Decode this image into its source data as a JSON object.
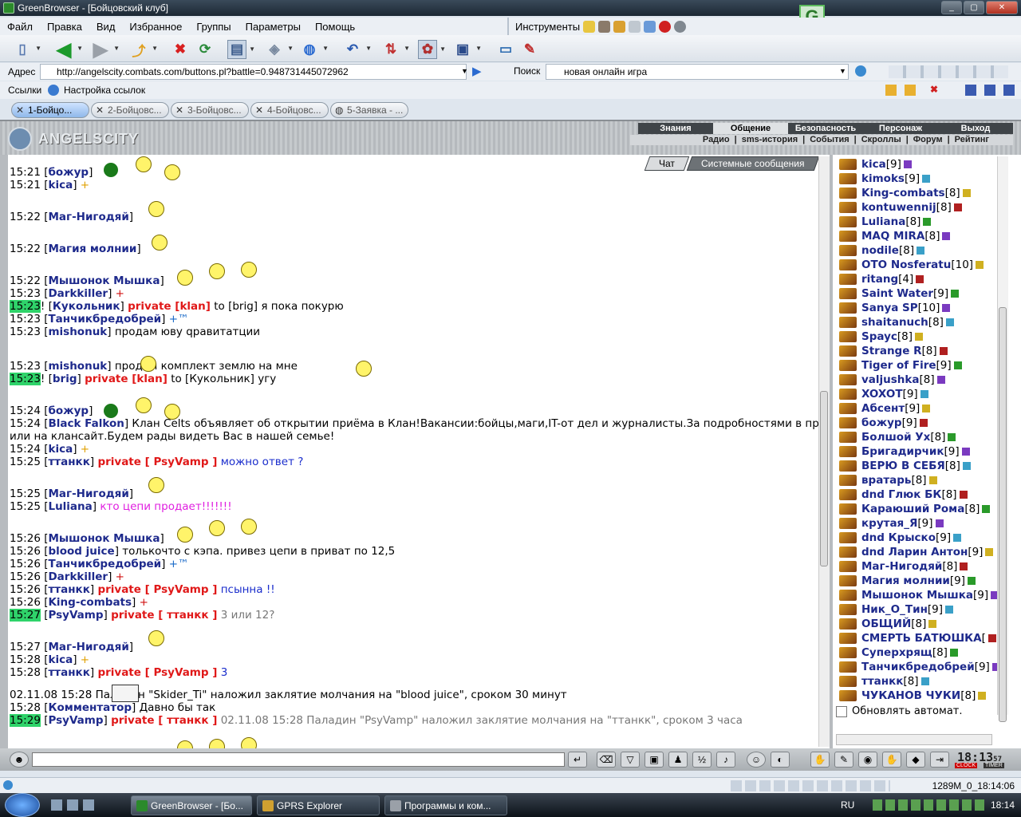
{
  "window": {
    "title": "GreenBrowser - [Бойцовский клуб]"
  },
  "menu": [
    "Файл",
    "Правка",
    "Вид",
    "Избранное",
    "Группы",
    "Параметры",
    "Помощь"
  ],
  "tools": {
    "label": "Инструменты"
  },
  "address": {
    "label": "Адрес",
    "url": "http://angelscity.combats.com/buttons.pl?battle=0.948731445072962"
  },
  "search": {
    "label": "Поиск",
    "value": "новая онлайн игра"
  },
  "links": {
    "label": "Ссылки",
    "item": "Настройка ссылок"
  },
  "tabs": [
    "1-Бойцо...",
    "2-Бойцовс...",
    "3-Бойцовс...",
    "4-Бойцовс...",
    "5-Заявка - ..."
  ],
  "game": {
    "logo": "ANGELSCITY",
    "nav1": [
      "Знания",
      "Общение",
      "Безопасность",
      "Персонаж",
      "Выход"
    ],
    "nav1_selected": "Общение",
    "nav2": [
      "Радио",
      "sms-история",
      "События",
      "Скроллы",
      "Форум",
      "Рейтинг"
    ]
  },
  "chat_tabs": [
    "Чат",
    "Системные сообщения"
  ],
  "chat": [
    {
      "time": "15:21",
      "nick": "божур",
      "rest": ""
    },
    {
      "time": "15:21",
      "nick": "kica",
      "plus": "+"
    },
    {
      "time": "15:22",
      "nick": "Маг-Нигодяй",
      "rest": ""
    },
    {
      "time": "15:22",
      "nick": "Магия молнии",
      "rest": ""
    },
    {
      "time": "15:22",
      "nick": "Мышонок Мышка",
      "rest": ""
    },
    {
      "time": "15:23",
      "nick": "Darkkiller",
      "plus": "+"
    },
    {
      "time": "15:23",
      "hl": true,
      "pre": "! ",
      "nick": "Кукольник",
      "priv": "private [klan]",
      "mid": " to [brig] ",
      "rest": "я пока покурю"
    },
    {
      "time": "15:23",
      "nick": "Танчикбредобрей",
      "plus": "+™"
    },
    {
      "time": "15:23",
      "nick": "mishonuk",
      "rest": "продам юву qравитатции"
    },
    {
      "time": "15:23",
      "nick": "mishonuk",
      "rest": "продам комплект землю на мне"
    },
    {
      "time": "15:23",
      "hl": true,
      "pre": "! ",
      "nick": "brig",
      "priv": "private [klan]",
      "mid": " to [Кукольник] ",
      "rest": "угу"
    },
    {
      "time": "15:24",
      "nick": "божур",
      "rest": ""
    },
    {
      "time": "15:24",
      "nick": "Black Falkon",
      "rest": "Клан Celts объявляет об открытии приёма в Клан!Вакансии:бойцы,маги,IT-от дел и журналисты.За подробностями в приват"
    },
    {
      "cont": "или на клансайт.Будем рады видеть Вас в нашей семье!"
    },
    {
      "time": "15:24",
      "nick": "kica",
      "plus": "+"
    },
    {
      "time": "15:25",
      "nick": "ттанкк",
      "priv": "private [ PsyVamp ]",
      "rest": "можно ответ ?"
    },
    {
      "time": "15:25",
      "nick": "Маг-Нигодяй",
      "rest": ""
    },
    {
      "time": "15:25",
      "nick": "Luliana",
      "rest": "кто цепи продает!!!!!!!"
    },
    {
      "time": "15:26",
      "nick": "Мышонок Мышка",
      "rest": ""
    },
    {
      "time": "15:26",
      "nick": "blood juice",
      "rest": "толькочто с кэпа. привез цепи в приват по 12,5"
    },
    {
      "time": "15:26",
      "nick": "Танчикбредобрей",
      "plus": "+™"
    },
    {
      "time": "15:26",
      "nick": "Darkkiller",
      "plus": "+"
    },
    {
      "time": "15:26",
      "nick": "ттанкк",
      "priv": "private [ PsyVamp ]",
      "rest": "псынна !!"
    },
    {
      "time": "15:26",
      "nick": "King-combats",
      "plus": "+"
    },
    {
      "time": "15:27",
      "hl": true,
      "nick": "PsyVamp",
      "priv": "private [ ттанкк ]",
      "rest": "3 или 12?"
    },
    {
      "time": "15:27",
      "nick": "Маг-Нигодяй",
      "rest": ""
    },
    {
      "time": "15:28",
      "nick": "kica",
      "plus": "+"
    },
    {
      "time": "15:28",
      "nick": "ттанкк",
      "priv": "private [ PsyVamp ]",
      "rest": "3"
    },
    {
      "sys": "02.11.08 15:28",
      "rest": "Паладин \"Skider_Ti\" наложил заклятие молчания на \"blood juice\", сроком 30 минут"
    },
    {
      "time": "15:28",
      "nick": "Комментатор",
      "rest": "Давно бы так"
    },
    {
      "time": "15:29",
      "hl": true,
      "nick": "PsyVamp",
      "priv": "private [ ттанкк ]",
      "rest": "02.11.08 15:28 Паладин \"PsyVamp\" наложил заклятие молчания на \"ттанкк\", сроком 3 часа"
    }
  ],
  "users": [
    {
      "name": "kica",
      "lvl": "[9]"
    },
    {
      "name": "kimoks",
      "lvl": "[9]"
    },
    {
      "name": "King-combats",
      "lvl": "[8]"
    },
    {
      "name": "kontuwennij",
      "lvl": "[8]"
    },
    {
      "name": "Luliana",
      "lvl": "[8]"
    },
    {
      "name": "MAQ MIRA",
      "lvl": "[8]"
    },
    {
      "name": "nodile",
      "lvl": "[8]"
    },
    {
      "name": "OTO Nosferatu",
      "lvl": "[10]"
    },
    {
      "name": "ritang",
      "lvl": "[4]"
    },
    {
      "name": "Saint Water",
      "lvl": "[9]"
    },
    {
      "name": "Sanya SP",
      "lvl": "[10]"
    },
    {
      "name": "shaitanuch",
      "lvl": "[8]"
    },
    {
      "name": "Spayc",
      "lvl": "[8]"
    },
    {
      "name": "Strange R",
      "lvl": "[8]"
    },
    {
      "name": "Tiger of Fire",
      "lvl": "[9]"
    },
    {
      "name": "valjushka",
      "lvl": "[8]"
    },
    {
      "name": "XOXOT",
      "lvl": "[9]"
    },
    {
      "name": "Абсент",
      "lvl": "[9]"
    },
    {
      "name": "божур",
      "lvl": "[9]"
    },
    {
      "name": "Болшой Ух",
      "lvl": "[8]"
    },
    {
      "name": "Бригадирчик",
      "lvl": "[9]"
    },
    {
      "name": "ВЕРЮ В СЕБЯ",
      "lvl": "[8]"
    },
    {
      "name": "вратарь",
      "lvl": "[8]"
    },
    {
      "name": "dnd Глюк БК",
      "lvl": "[8]"
    },
    {
      "name": "Караюший Рома",
      "lvl": "[8]"
    },
    {
      "name": "крутая_Я",
      "lvl": "[9]"
    },
    {
      "name": "dnd Крыско",
      "lvl": "[9]"
    },
    {
      "name": "dnd Ларин Антон",
      "lvl": "[9]"
    },
    {
      "name": "Маг-Нигодяй",
      "lvl": "[8]"
    },
    {
      "name": "Магия молнии",
      "lvl": "[9]"
    },
    {
      "name": "Мышонок Мышка",
      "lvl": "[9]"
    },
    {
      "name": "Ник_О_Тин",
      "lvl": "[9]"
    },
    {
      "name": "ОБЩИЙ",
      "lvl": "[8]"
    },
    {
      "name": "СМЕРТЬ БАТЮШКА",
      "lvl": "["
    },
    {
      "name": "Суперхрящ",
      "lvl": "[8]"
    },
    {
      "name": "Танчикбредобрей",
      "lvl": "[9]"
    },
    {
      "name": "ттанкк",
      "lvl": "[8]"
    },
    {
      "name": "ЧУКАНОВ ЧУКИ",
      "lvl": "[8]"
    }
  ],
  "auto_update": "Обновлять автомат.",
  "clock": {
    "time": "18:13",
    "sec": "57",
    "clock_label": "CLOCK",
    "timer_label": "TIMER"
  },
  "status": {
    "text": "1289M_0_18:14:06"
  },
  "taskbar": {
    "tasks": [
      "GreenBrowser - [Бо...",
      "GPRS Explorer",
      "Программы и ком..."
    ],
    "lang": "RU",
    "time": "18:14"
  }
}
